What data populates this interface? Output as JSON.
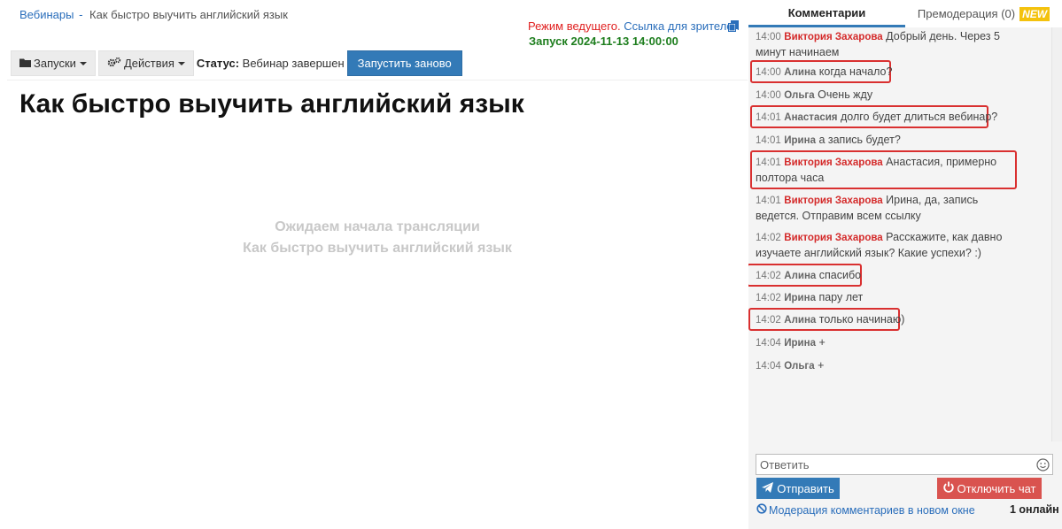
{
  "breadcrumb": {
    "root": "Вебинары",
    "separator": "-",
    "current": "Как быстро выучить английский язык"
  },
  "header": {
    "mode": "Режим ведущего.",
    "viewer_link": "Ссылка для зрителей",
    "launch": "Запуск 2024-11-13 14:00:00"
  },
  "toolbar": {
    "launches": "Запуски",
    "actions": "Действия",
    "status_label": "Статус:",
    "status_value": "Вебинар завершен",
    "restart": "Запустить заново"
  },
  "page": {
    "title": "Как быстро выучить английский язык",
    "waiting_line1": "Ожидаем начала трансляции",
    "waiting_line2": "Как быстро выучить английский язык"
  },
  "chat": {
    "tab_comments": "Комментарии",
    "tab_premod": "Премодерация (0)",
    "badge_new": "NEW",
    "messages": [
      {
        "time": "14:00",
        "author": "Виктория Захарова",
        "text": "Добрый день. Через 5 минут начинаем",
        "host": true,
        "highlighted": false
      },
      {
        "time": "14:00",
        "author": "Алина",
        "text": "когда начало?",
        "host": false,
        "highlighted": true
      },
      {
        "time": "14:00",
        "author": "Ольга",
        "text": "Очень жду",
        "host": false,
        "highlighted": false
      },
      {
        "time": "14:01",
        "author": "Анастасия",
        "text": "долго будет длиться вебинар?",
        "host": false,
        "highlighted": true
      },
      {
        "time": "14:01",
        "author": "Ирина",
        "text": "а запись будет?",
        "host": false,
        "highlighted": false
      },
      {
        "time": "14:01",
        "author": "Виктория Захарова",
        "text": "Анастасия, примерно полтора часа",
        "host": true,
        "highlighted": true
      },
      {
        "time": "14:01",
        "author": "Виктория Захарова",
        "text": "Ирина, да, запись ведется. Отправим всем ссылку",
        "host": true,
        "highlighted": false
      },
      {
        "time": "14:02",
        "author": "Виктория Захарова",
        "text": "Расскажите, как давно изучаете английский язык? Какие успехи? :)",
        "host": true,
        "highlighted": false
      },
      {
        "time": "14:02",
        "author": "Алина",
        "text": "спасибо",
        "host": false,
        "highlighted": true
      },
      {
        "time": "14:02",
        "author": "Ирина",
        "text": "пару лет",
        "host": false,
        "highlighted": false
      },
      {
        "time": "14:02",
        "author": "Алина",
        "text": "только начинаю)",
        "host": false,
        "highlighted": true
      },
      {
        "time": "14:04",
        "author": "Ирина",
        "text": "+",
        "host": false,
        "highlighted": false
      },
      {
        "time": "14:04",
        "author": "Ольга",
        "text": "+",
        "host": false,
        "highlighted": false
      }
    ],
    "reply_placeholder": "Ответить",
    "send": "Отправить",
    "disable_chat": "Отключить чат",
    "moderation_link": "Модерация комментариев в новом окне",
    "online": "1 онлайн"
  },
  "colors": {
    "accent": "#337ab7",
    "host_name": "#d42a2a",
    "launch_green": "#1e7e1e",
    "danger": "#d9534f",
    "highlight": "#d93030",
    "badge_new": "#f4c20d"
  }
}
